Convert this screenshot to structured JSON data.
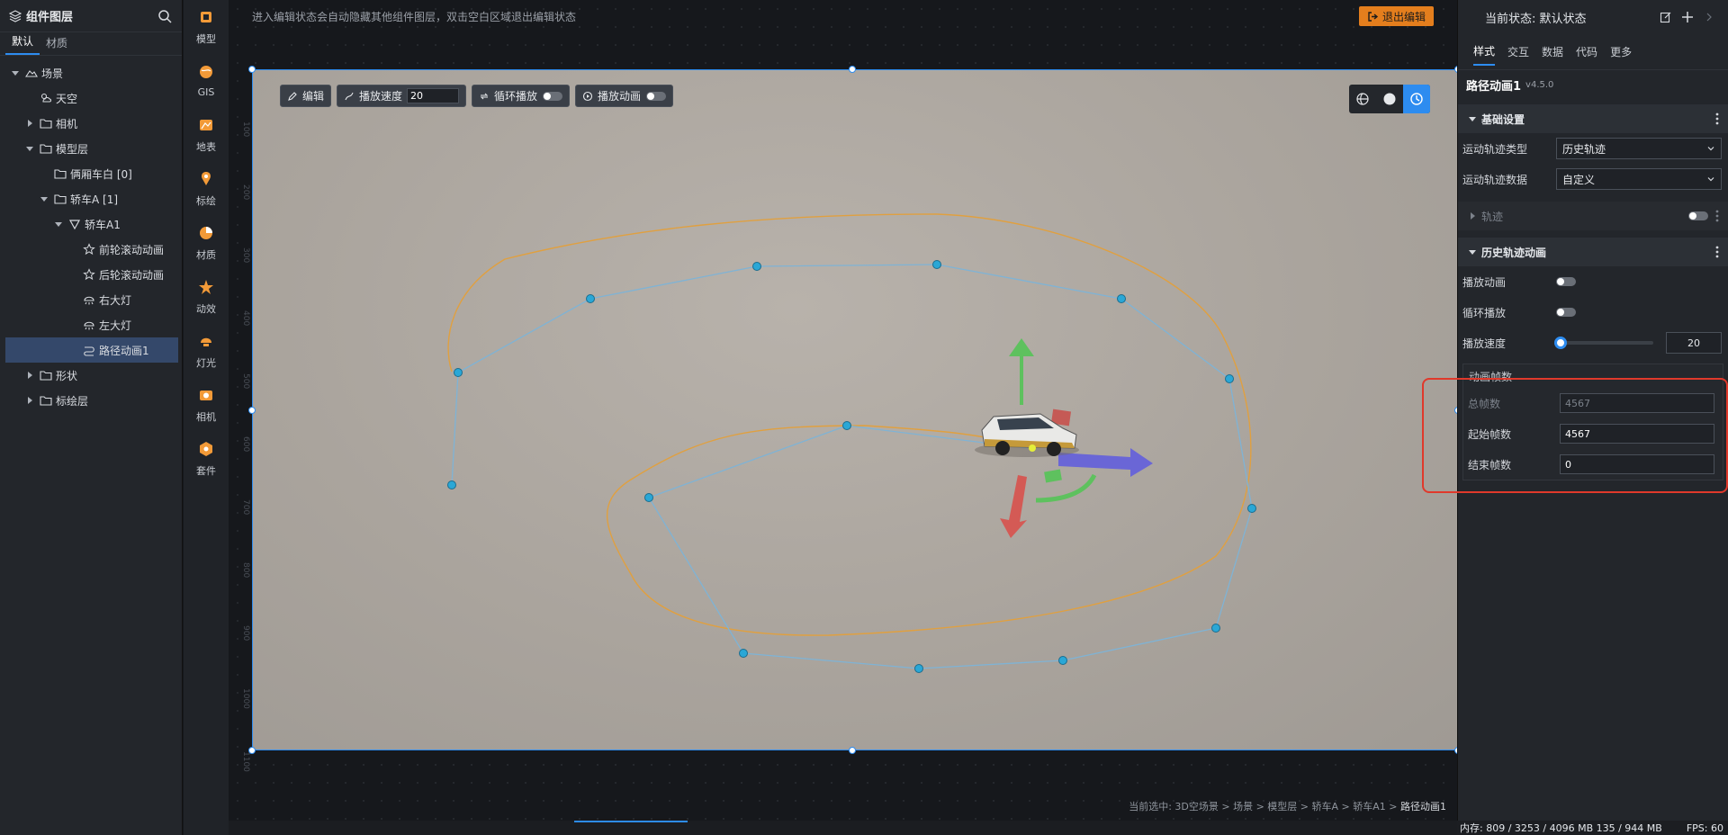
{
  "layer_panel": {
    "title": "组件图层",
    "tabs": [
      "默认",
      "材质"
    ],
    "tree": [
      {
        "label": "场景",
        "level": 0,
        "arrow": "down",
        "icon": "mountain-icon"
      },
      {
        "label": "天空",
        "level": 1,
        "arrow": "none",
        "icon": "sun-cloud-icon"
      },
      {
        "label": "相机",
        "level": 1,
        "arrow": "right",
        "icon": "folder-icon"
      },
      {
        "label": "模型层",
        "level": 1,
        "arrow": "down",
        "icon": "folder-icon"
      },
      {
        "label": "俩厢车白 [0]",
        "level": 2,
        "arrow": "none",
        "icon": "folder-icon"
      },
      {
        "label": "轿车A [1]",
        "level": 2,
        "arrow": "down",
        "icon": "folder-icon"
      },
      {
        "label": "轿车A1",
        "level": 3,
        "arrow": "down",
        "icon": "triangle-icon"
      },
      {
        "label": "前轮滚动动画",
        "level": 4,
        "arrow": "none",
        "icon": "star-icon"
      },
      {
        "label": "后轮滚动动画",
        "level": 4,
        "arrow": "none",
        "icon": "star-icon"
      },
      {
        "label": "右大灯",
        "level": 4,
        "arrow": "none",
        "icon": "lamp-icon"
      },
      {
        "label": "左大灯",
        "level": 4,
        "arrow": "none",
        "icon": "lamp-icon"
      },
      {
        "label": "路径动画1",
        "level": 4,
        "arrow": "none",
        "icon": "path-icon",
        "selected": true
      },
      {
        "label": "形状",
        "level": 1,
        "arrow": "right",
        "icon": "folder-icon"
      },
      {
        "label": "标绘层",
        "level": 1,
        "arrow": "right",
        "icon": "folder-icon"
      }
    ]
  },
  "tool_strip": [
    {
      "label": "模型",
      "icon": "model-icon",
      "color": "#f29a38"
    },
    {
      "label": "GIS",
      "icon": "globe-icon",
      "color": "#f29a38"
    },
    {
      "label": "地表",
      "icon": "terrain-icon",
      "color": "#f29a38"
    },
    {
      "label": "标绘",
      "icon": "pin-icon",
      "color": "#f29a38"
    },
    {
      "label": "材质",
      "icon": "material-icon",
      "color": "#f29a38"
    },
    {
      "label": "动效",
      "icon": "effect-icon",
      "color": "#f29a38"
    },
    {
      "label": "灯光",
      "icon": "light-icon",
      "color": "#f29a38"
    },
    {
      "label": "相机",
      "icon": "camera-icon",
      "color": "#f29a38"
    },
    {
      "label": "套件",
      "icon": "kit-icon",
      "color": "#f29a38"
    }
  ],
  "canvas": {
    "hint": "进入编辑状态会自动隐藏其他组件图层，双击空白区域退出编辑状态",
    "exit_button": "退出编辑",
    "ruler_ticks": [
      "100",
      "200",
      "300",
      "400",
      "500",
      "600",
      "700",
      "800",
      "900",
      "1000",
      "1100"
    ],
    "toolbar": {
      "edit_label": "编辑",
      "speed_label": "播放速度",
      "speed_value": "20",
      "loop_label": "循环播放",
      "play_label": "播放动画"
    },
    "breadcrumb": {
      "prefix": "当前选中: 3D空场景 > 场景 > 模型层 > 轿车A > 轿车A1 > ",
      "current": "路径动画1"
    }
  },
  "prop_panel": {
    "state_label": "当前状态: 默认状态",
    "tabs": [
      "样式",
      "交互",
      "数据",
      "代码",
      "更多"
    ],
    "component_name": "路径动画1",
    "component_version": "v4.5.0",
    "basic_section": "基础设置",
    "track_type_label": "运动轨迹类型",
    "track_type_value": "历史轨迹",
    "track_data_label": "运动轨迹数据",
    "track_data_value": "自定义",
    "track_section": "轨迹",
    "history_section": "历史轨迹动画",
    "play_anim_label": "播放动画",
    "loop_label": "循环播放",
    "speed_label": "播放速度",
    "speed_value": "20",
    "frames_group": "动画帧数",
    "total_frames_label": "总帧数",
    "total_frames_value": "4567",
    "start_frame_label": "起始帧数",
    "start_frame_value": "4567",
    "end_frame_label": "结束帧数",
    "end_frame_value": "0"
  },
  "status_bar": {
    "memory": "内存: 809 / 3253 / 4096 MB 135 / 944 MB",
    "fps": "FPS: 60"
  },
  "colors": {
    "accent": "#2d8cf0",
    "exit_button": "#e47e1d",
    "highlight": "#e0392b",
    "path_orange": "#e0a040",
    "path_blue": "#7fb3d5"
  }
}
